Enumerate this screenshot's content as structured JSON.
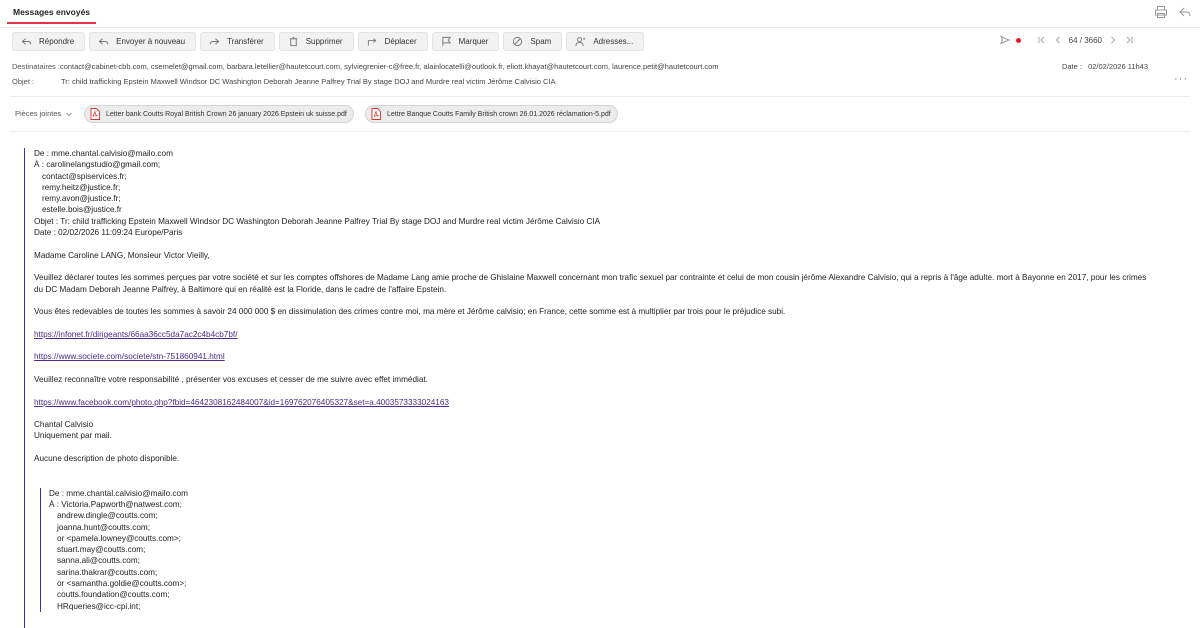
{
  "tab": {
    "label": "Messages envoyés"
  },
  "toolbar": {
    "buttons": [
      {
        "label": "Répondre",
        "icon": "reply-icon"
      },
      {
        "label": "Envoyer à nouveau",
        "icon": "resend-icon"
      },
      {
        "label": "Transférer",
        "icon": "forward-icon"
      },
      {
        "label": "Supprimer",
        "icon": "trash-icon"
      },
      {
        "label": "Déplacer",
        "icon": "move-icon"
      },
      {
        "label": "Marquer",
        "icon": "flag-icon"
      },
      {
        "label": "Spam",
        "icon": "spam-icon"
      },
      {
        "label": "Adresses...",
        "icon": "contacts-icon"
      }
    ]
  },
  "pager": {
    "position": "64 / 3660"
  },
  "header": {
    "to_label": "Destinataires :",
    "to_value": "contact@cabinet-cbb.com, csemelet@gmail.com, barbara.letellier@hautetcourt.com, sylviegrenier-c@free.fr, alainlocatelli@outlook.fr, eliott.khayat@hautetcourt.com, laurence.petit@hautetcourt.com",
    "subject_label": "Objet :",
    "subject_value": "Tr: child trafficking Epstein Maxwell Windsor DC Washington Deborah Jeanne Palfrey Trial By stage DOJ and Murdre real victim Jérôme Calvisio CIA",
    "date_label": "Date :",
    "date_value": "02/02/2026 11h43",
    "more": "···"
  },
  "attachments": {
    "label": "Pièces jointes",
    "files": [
      "Letter bank Coutts Royal British Crown 26 january 2026 Epstein uk suisse.pdf",
      "Lettre Banque Coutts Family British crown 26.01.2026 réclamation-5.pdf"
    ]
  },
  "body": {
    "from": "De : mme.chantal.calvisio@mailo.com",
    "to_first": "À : carolinelangstudio@gmail.com;",
    "to_rest": [
      "contact@spiservices.fr;",
      "remy.heitz@justice.fr;",
      "remy.avon@justice.fr;",
      "estelle.bois@justice.fr"
    ],
    "subject": "Objet : Tr: child trafficking Epstein Maxwell Windsor DC Washington Deborah Jeanne Palfrey Trial By stage DOJ and Murdre real victim Jérôme Calvisio CIA",
    "date": "Date : 02/02/2026 11:09:24 Europe/Paris",
    "greeting": "Madame Caroline LANG, Monsieur Victor Vieilly,",
    "p1": "Veuillez déclarer toutes les sommes perçues par votre société et sur les comptes offshores de Madame Lang amie proche de Ghislaine Maxwell concernant mon trafic sexuel par contrainte et celui de mon cousin jérôme Alexandre Calvisio, qui a repris à l'âge adulte. mort à Bayonne en 2017, pour les crimes du DC Madam Deborah Jeanne Palfrey, à Baltimore qui en réalité est la Floride, dans le cadre de l'affaire Epstein.",
    "p2": "Vous êtes redevables de toutes les sommes à savoir 24 000 000 $ en dissimulation des crimes contre moi, ma mère et Jérôme calvisio; en France, cette somme est à multiplier par trois pour le préjudice subi.",
    "link1": "https://infonet.fr/dirigeants/66aa36cc5da7ac2c4b4cb7bf/",
    "link2": "https://www.societe.com/societe/stn-751860941.html",
    "p3": "Veuillez reconnaître votre responsabilité , présenter vos excuses et cesser de me suivre avec effet immédiat.",
    "link3": "https://www.facebook.com/photo.php?fbid=4642308162484007&id=169762076405327&set=a.4003573333024163",
    "sign1": "Chantal Calvisio",
    "sign2": "Uniquement par mail.",
    "p4": "Aucune description de photo disponible.",
    "quote": {
      "from": "De : mme.chantal.calvisio@mailo.com",
      "to_first": "À : Victoria.Papworth@natwest.com;",
      "to_rest": [
        "andrew.dingle@coutts.com;",
        "joanna.hunt@coutts.com;",
        "or <pamela.lowney@coutts.com>;",
        "stuart.may@coutts.com;",
        "sanna.ali@coutts.com;",
        "sarina.thakrar@coutts.com;",
        "or <samantha.goldie@coutts.com>;",
        "coutts.foundation@coutts.com;",
        "HRqueries@icc-cpi.int;"
      ]
    }
  }
}
